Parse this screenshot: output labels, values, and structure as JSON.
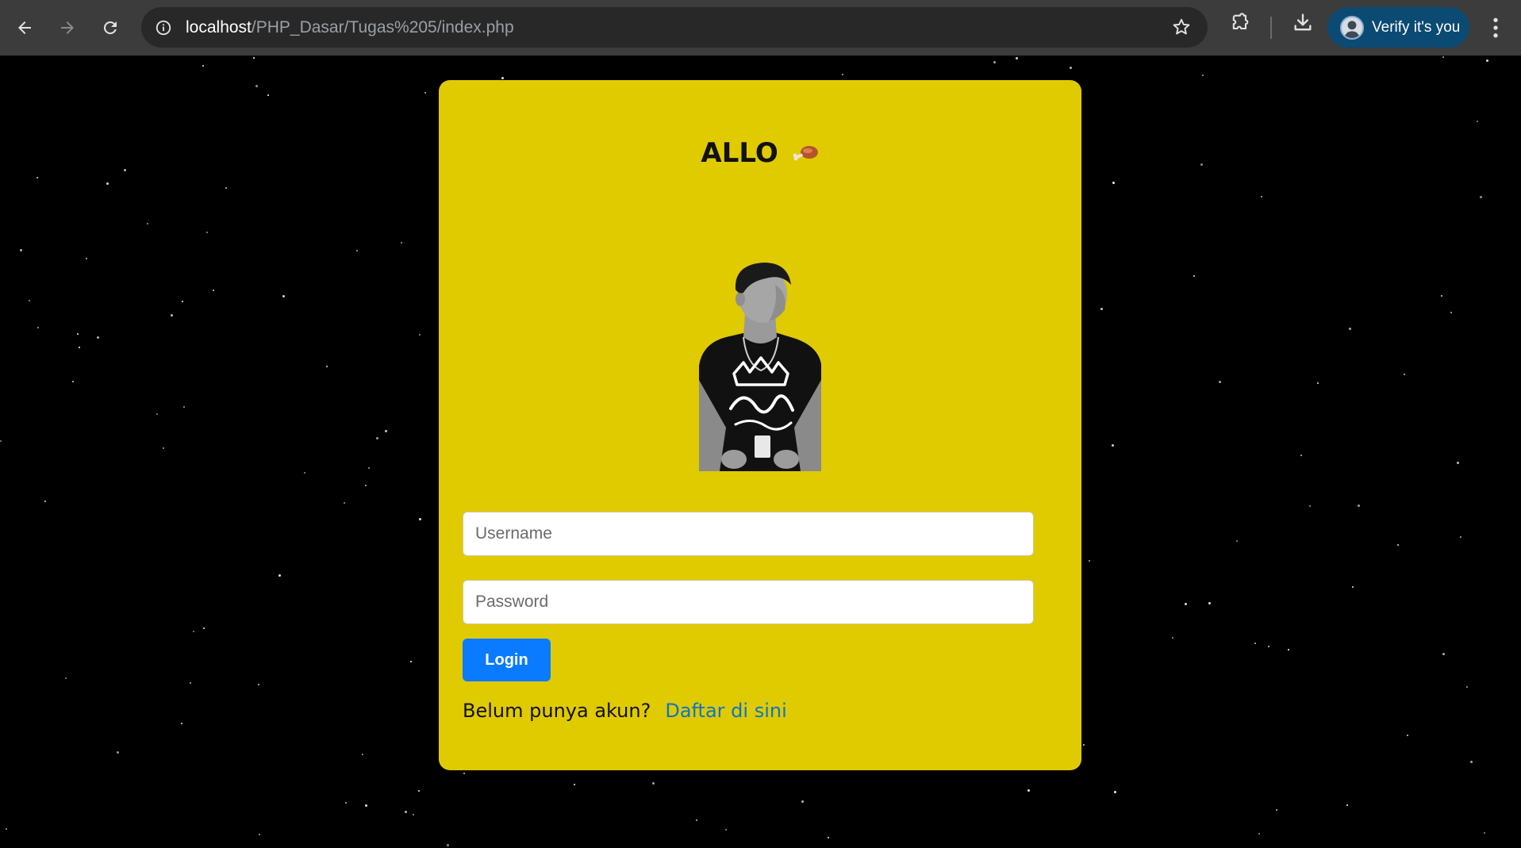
{
  "browser": {
    "url_host": "localhost",
    "url_path": "/PHP_Dasar/Tugas%205/index.php",
    "verify_label": "Verify it's you"
  },
  "login_card": {
    "title": "ALLO",
    "title_emoji": "drumstick-emoji",
    "colors": {
      "card": "#e0ca00",
      "button": "#0a7bff",
      "link": "#0b76c7",
      "background": "#000000"
    },
    "username_placeholder": "Username",
    "password_placeholder": "Password",
    "login_label": "Login",
    "signup_prompt": "Belum punya akun?",
    "signup_link": "Daftar di sini"
  }
}
